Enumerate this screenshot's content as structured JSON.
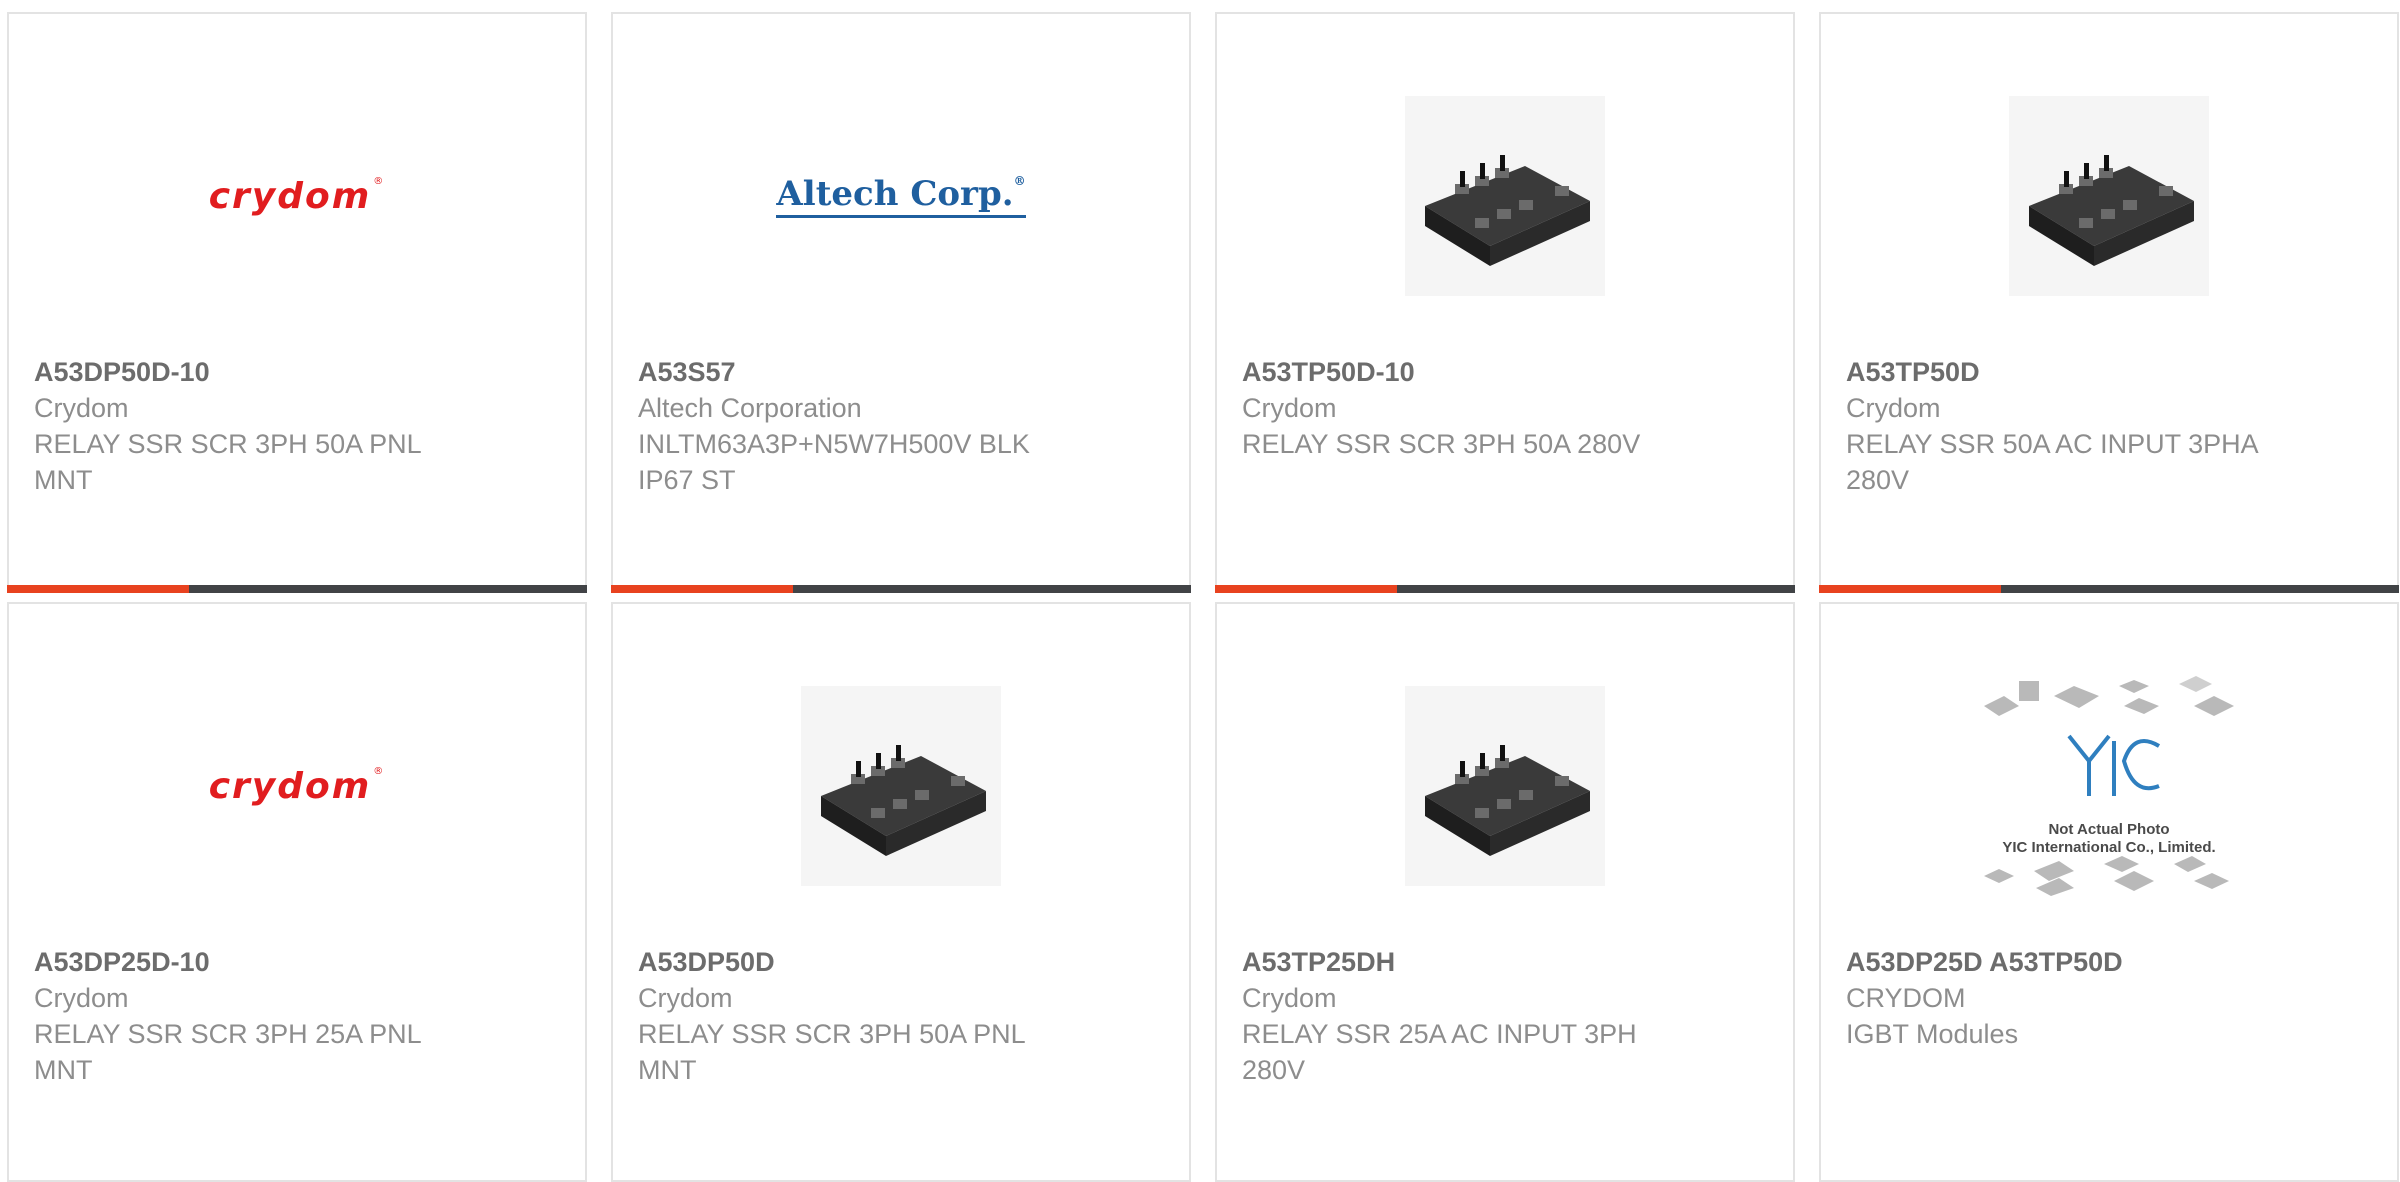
{
  "products": [
    {
      "part_number": "A53DP50D-10",
      "manufacturer": "Crydom",
      "description": "RELAY SSR SCR 3PH 50A PNL MNT",
      "image": "crydom-logo"
    },
    {
      "part_number": "A53S57",
      "manufacturer": "Altech Corporation",
      "description": "INLTM63A3P+N5W7H500V BLK IP67 ST",
      "image": "altech-logo"
    },
    {
      "part_number": "A53TP50D-10",
      "manufacturer": "Crydom",
      "description": "RELAY SSR SCR 3PH 50A 280V",
      "image": "relay-photo"
    },
    {
      "part_number": "A53TP50D",
      "manufacturer": "Crydom",
      "description": "RELAY SSR 50A AC INPUT 3PHA 280V",
      "image": "relay-photo"
    },
    {
      "part_number": "A53DP25D-10",
      "manufacturer": "Crydom",
      "description": "RELAY SSR SCR 3PH 25A PNL MNT",
      "image": "crydom-logo"
    },
    {
      "part_number": "A53DP50D",
      "manufacturer": "Crydom",
      "description": "RELAY SSR SCR 3PH 50A PNL MNT",
      "image": "relay-photo"
    },
    {
      "part_number": "A53TP25DH",
      "manufacturer": "Crydom",
      "description": "RELAY SSR 25A AC INPUT 3PH 280V",
      "image": "relay-photo"
    },
    {
      "part_number": "A53DP25D A53TP50D",
      "manufacturer": "CRYDOM",
      "description": "IGBT Modules",
      "image": "yic-placeholder"
    }
  ],
  "logos": {
    "crydom": "crydom",
    "altech": "Altech Corp.",
    "yic_caption_1": "Not Actual Photo",
    "yic_caption_2": "YIC International Co., Limited."
  },
  "colors": {
    "accent": "#e8421f",
    "bar": "#414346",
    "crydom_red": "#e11d1f",
    "altech_blue": "#1f5f9f"
  }
}
